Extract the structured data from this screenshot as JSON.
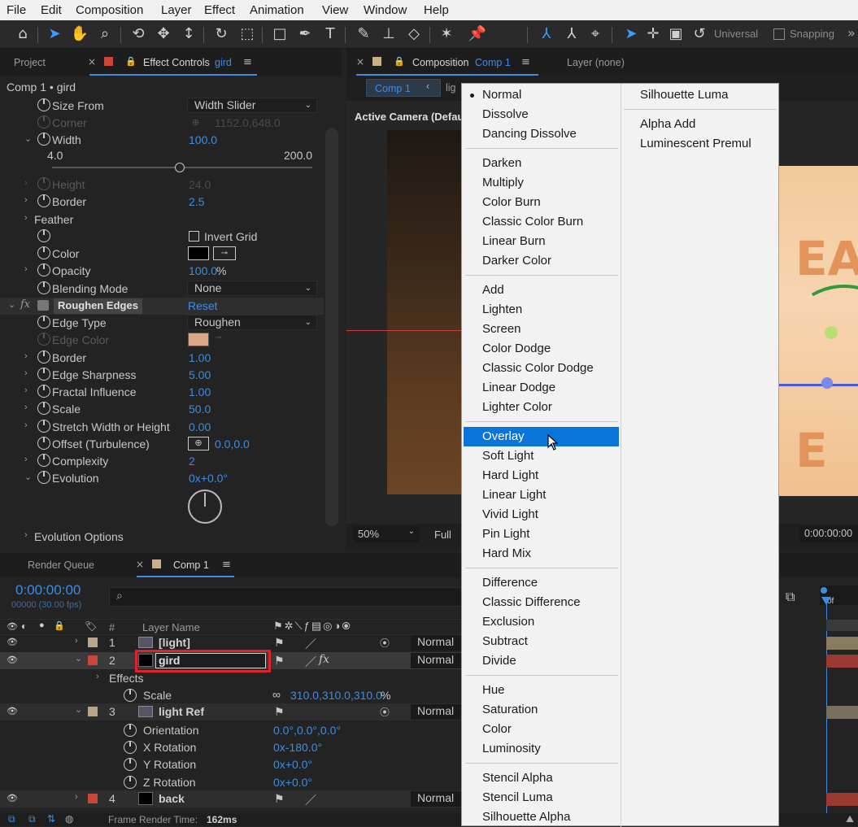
{
  "menubar": {
    "items": [
      "File",
      "Edit",
      "Composition",
      "Layer",
      "Effect",
      "Animation",
      "View",
      "Window",
      "Help"
    ]
  },
  "toolbar": {
    "universal_label": "Universal",
    "snapping_label": "Snapping"
  },
  "left_panel": {
    "tab_project": "Project",
    "tab_effect_controls": "Effect Controls",
    "tab_effect_controls_layer": "gird",
    "breadcrumb": "Comp 1 • gird",
    "props": {
      "size_from": "Size From",
      "size_from_value": "Width Slider",
      "corner": "Corner",
      "corner_value": "1152.0,648.0",
      "width": "Width",
      "width_value": "100.0",
      "width_min": "4.0",
      "width_max": "200.0",
      "width_slider_fraction": 0.49,
      "height": "Height",
      "height_value": "24.0",
      "border": "Border",
      "border_value": "2.5",
      "feather": "Feather",
      "invert_grid": "Invert Grid",
      "color": "Color",
      "opacity": "Opacity",
      "opacity_value": "100.0",
      "opacity_unit": "%",
      "blending_mode": "Blending Mode",
      "blending_mode_value": "None",
      "roughen_edges": "Roughen Edges",
      "reset": "Reset",
      "edge_type": "Edge Type",
      "edge_type_value": "Roughen",
      "edge_color": "Edge Color",
      "border2": "Border",
      "border2_value": "1.00",
      "edge_sharpness": "Edge Sharpness",
      "edge_sharpness_value": "5.00",
      "fractal_influence": "Fractal Influence",
      "fractal_influence_value": "1.00",
      "scale": "Scale",
      "scale_value": "50.0",
      "stretch": "Stretch Width or Height",
      "stretch_value": "0.00",
      "offset": "Offset (Turbulence)",
      "offset_value": "0.0,0.0",
      "complexity": "Complexity",
      "complexity_value": "2",
      "evolution": "Evolution",
      "evolution_value": "0x+0.0°",
      "evolution_options": "Evolution Options"
    }
  },
  "comp_panel": {
    "tab_composition": "Composition",
    "tab_comp_name": "Comp 1",
    "tab_layer": "Layer (none)",
    "sub_tab": "Comp 1",
    "sub_tab2": "lig",
    "camera_label": "Active Camera (Defau",
    "zoom": "50%",
    "quality": "Full",
    "timecode": "0:00:00:00"
  },
  "timeline": {
    "tab_render_queue": "Render Queue",
    "tab_comp": "Comp 1",
    "timecode": "0:00:00:00",
    "frames": "00000 (30.00 fps)",
    "search_placeholder": "",
    "col_num": "#",
    "col_layer_name": "Layer Name",
    "ruler_label": "0f",
    "layers": [
      {
        "num": "1",
        "name": "[light]",
        "mode": "Normal",
        "color": "#b8a68a"
      },
      {
        "num": "2",
        "name": "gird",
        "mode": "Normal",
        "color": "#c8473a"
      },
      {
        "num": "3",
        "name": "light Ref",
        "mode": "Normal",
        "color": "#b8a68a"
      },
      {
        "num": "4",
        "name": "back",
        "mode": "Normal",
        "color": "#c8473a"
      }
    ],
    "effects_label": "Effects",
    "scale_label": "Scale",
    "scale_value": "310.0,310.0,310.0",
    "scale_unit": "%",
    "orientation_label": "Orientation",
    "orientation_value": "0.0°,0.0°,0.0°",
    "xrot_label": "X Rotation",
    "xrot_value": "0x-180.0°",
    "yrot_label": "Y Rotation",
    "yrot_value": "0x+0.0°",
    "zrot_label": "Z Rotation",
    "zrot_value": "0x+0.0°"
  },
  "status": {
    "frame_render_label": "Frame Render Time:",
    "frame_render_value": "162ms"
  },
  "blend_menu": {
    "selected": "Normal",
    "highlighted": "Overlay",
    "groups_left": [
      [
        "Normal",
        "Dissolve",
        "Dancing Dissolve"
      ],
      [
        "Darken",
        "Multiply",
        "Color Burn",
        "Classic Color Burn",
        "Linear Burn",
        "Darker Color"
      ],
      [
        "Add",
        "Lighten",
        "Screen",
        "Color Dodge",
        "Classic Color Dodge",
        "Linear Dodge",
        "Lighter Color"
      ],
      [
        "Overlay",
        "Soft Light",
        "Hard Light",
        "Linear Light",
        "Vivid Light",
        "Pin Light",
        "Hard Mix"
      ],
      [
        "Difference",
        "Classic Difference",
        "Exclusion",
        "Subtract",
        "Divide"
      ],
      [
        "Hue",
        "Saturation",
        "Color",
        "Luminosity"
      ],
      [
        "Stencil Alpha",
        "Stencil Luma",
        "Silhouette Alpha"
      ]
    ],
    "groups_right": [
      [
        "Silhouette Luma"
      ],
      [
        "Alpha Add",
        "Luminescent Premul"
      ]
    ]
  }
}
